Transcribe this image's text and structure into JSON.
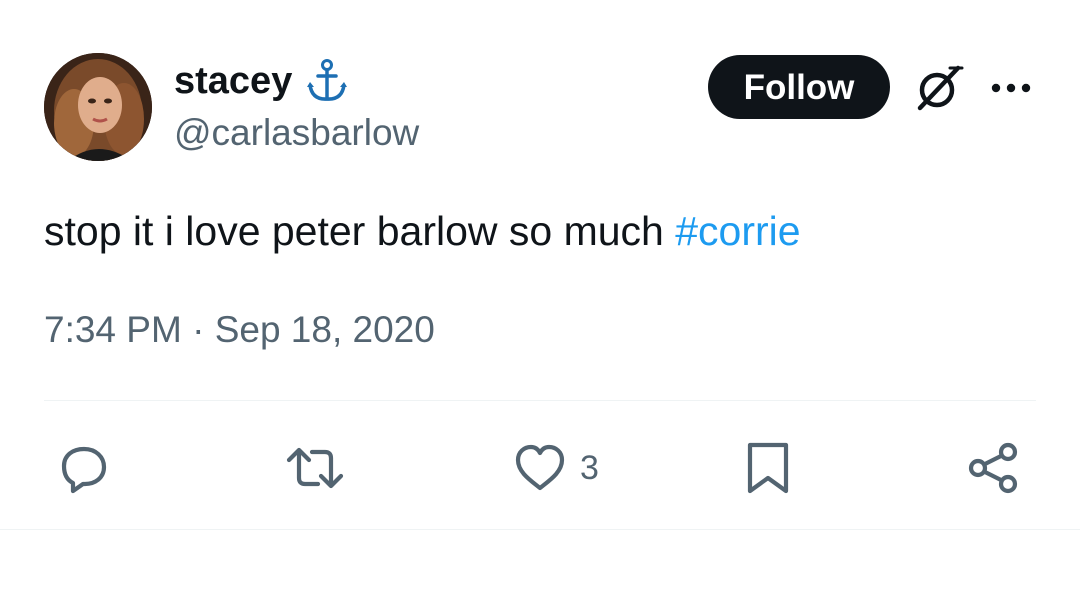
{
  "user": {
    "display_name": "stacey",
    "handle": "@carlasbarlow",
    "badge_icon": "anchor-icon",
    "badge_color": "#1d6fb3"
  },
  "header": {
    "follow_label": "Follow",
    "grok_icon": "grok-icon",
    "more_icon": "more-icon"
  },
  "tweet": {
    "text": "stop it i love peter barlow so much ",
    "hashtag": "#corrie",
    "time": "7:34 PM",
    "separator": " · ",
    "date": "Sep 18, 2020"
  },
  "actions": {
    "reply_icon": "reply-icon",
    "retweet_icon": "retweet-icon",
    "like_icon": "heart-icon",
    "like_count": "3",
    "bookmark_icon": "bookmark-icon",
    "share_icon": "share-icon"
  },
  "colors": {
    "text": "#0f1419",
    "secondary": "#536471",
    "link": "#1d9bf0",
    "button_bg": "#0f1419",
    "divider": "#eff3f4"
  }
}
